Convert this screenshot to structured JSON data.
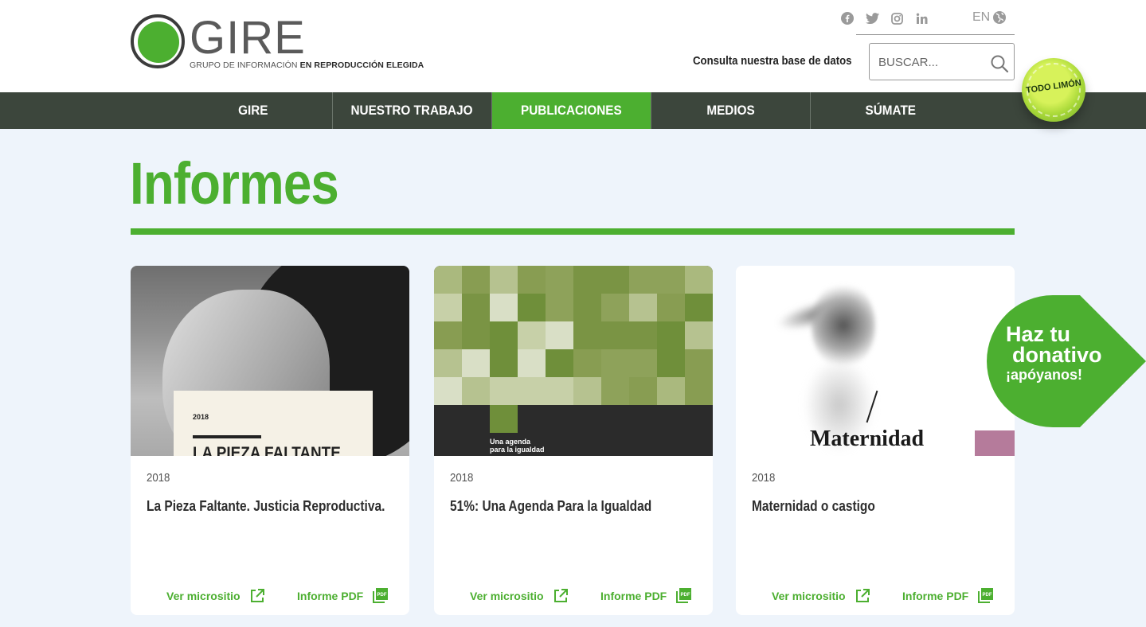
{
  "header": {
    "logo_word": "GIRE",
    "logo_tagline_light": "GRUPO DE INFORMACIÓN ",
    "logo_tagline_bold": "EN REPRODUCCIÓN ELEGIDA",
    "language": "EN",
    "db_label": "Consulta nuestra base de datos",
    "search_placeholder": "BUSCAR..."
  },
  "nav": {
    "items": [
      {
        "label": "GIRE"
      },
      {
        "label": "NUESTRO TRABAJO"
      },
      {
        "label": "PUBLICACIONES"
      },
      {
        "label": "MEDIOS"
      },
      {
        "label": "SÚMATE"
      }
    ],
    "active": "PUBLICACIONES",
    "badge": "TODO LIMÓN"
  },
  "page": {
    "title": "Informes"
  },
  "cards": [
    {
      "year": "2018",
      "title": "La Pieza Faltante. Justicia Reproductiva.",
      "cover_year": "2018",
      "cover_title": "LA PIEZA FALTANTE",
      "link_site": "Ver micrositio",
      "link_pdf": "Informe PDF"
    },
    {
      "year": "2018",
      "title": "51%: Una Agenda Para la Igualdad",
      "cover_caption_1": "Una agenda",
      "cover_caption_2": "para la igualdad",
      "link_site": "Ver micrositio",
      "link_pdf": "Informe PDF"
    },
    {
      "year": "2018",
      "title": "Maternidad o castigo",
      "cover_title": "Maternidad",
      "link_site": "Ver micrositio",
      "link_pdf": "Informe PDF"
    }
  ],
  "donate": {
    "line1": "Haz tu",
    "line2": "donativo",
    "line3": "¡apóyanos!"
  },
  "colors": {
    "brand_green": "#4caf30",
    "nav_bg": "#3c463c",
    "page_bg": "#eef4fb"
  }
}
